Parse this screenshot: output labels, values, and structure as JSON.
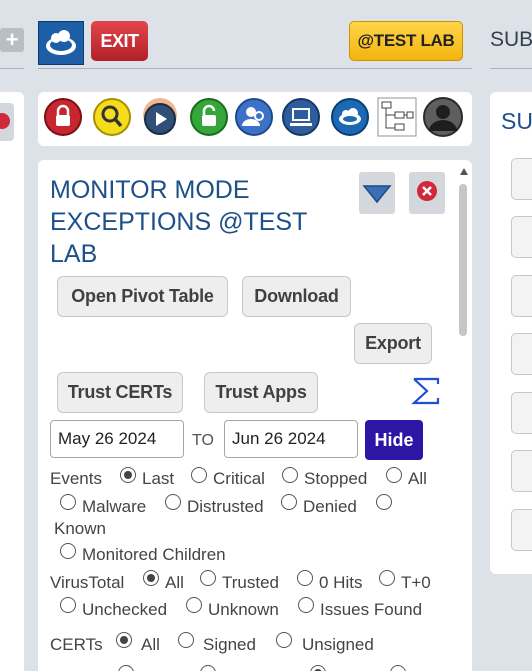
{
  "left_panel": {
    "add_icon": "plus-icon",
    "close_icon": "close-icon"
  },
  "header": {
    "logo_icon": "cloud-logo-icon",
    "exit_label": "EXIT",
    "lab_label": "@TEST LAB"
  },
  "right_panel": {
    "title": "SUB",
    "section_title": "SU"
  },
  "toolbar": {
    "icons": [
      "lock-icon",
      "search-icon",
      "play-icon",
      "unlock-icon",
      "users-icon",
      "computer-icon",
      "cloud-icon",
      "hierarchy-icon",
      "user-avatar-icon"
    ]
  },
  "panel": {
    "title": "MONITOR MODE EXCEPTIONS @TEST LAB",
    "filter_icon": "filter-funnel-icon",
    "close_icon": "close-icon",
    "open_pivot_label": "Open Pivot Table",
    "download_label": "Download",
    "export_label": "Export",
    "trust_certs_label": "Trust CERTs",
    "trust_apps_label": "Trust Apps",
    "sigma_icon": "sigma-icon",
    "date_from": "May 26 2024",
    "to_label": "TO",
    "date_to": "Jun 26 2024",
    "hide_label": "Hide"
  },
  "filters": {
    "events": {
      "label": "Events",
      "options": [
        "Last",
        "Critical",
        "Stopped",
        "All",
        "Malware",
        "Distrusted",
        "Denied",
        "Known",
        "Monitored Children"
      ],
      "selected": "Last"
    },
    "virustotal": {
      "label": "VirusTotal",
      "options": [
        "All",
        "Trusted",
        "0 Hits",
        "T+0",
        "Unchecked",
        "Unknown",
        "Issues Found"
      ],
      "selected": "All"
    },
    "certs": {
      "label": "CERTs",
      "options": [
        "All",
        "Signed",
        "Unsigned"
      ],
      "selected": "All"
    }
  }
}
